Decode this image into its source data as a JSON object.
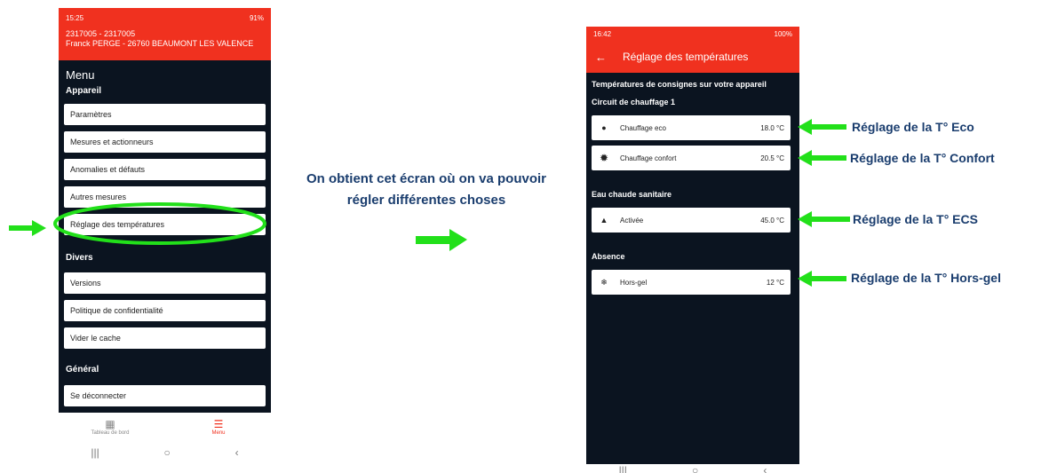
{
  "phone1": {
    "status_time": "15:25",
    "status_battery": "91%",
    "account_line1": "2317005 - 2317005",
    "account_line2": "Franck PERGE - 26760 BEAUMONT LES VALENCE",
    "menu_title": "Menu",
    "section_appareil": "Appareil",
    "appareil_items": [
      "Paramètres",
      "Mesures et actionneurs",
      "Anomalies et défauts",
      "Autres mesures",
      "Réglage des températures"
    ],
    "section_divers": "Divers",
    "divers_items": [
      "Versions",
      "Politique de confidentialité",
      "Vider le cache"
    ],
    "section_general": "Général",
    "general_items": [
      "Se déconnecter"
    ],
    "tab_dashboard": "Tableau de bord",
    "tab_menu": "Menu"
  },
  "center_caption": "On obtient cet écran où on va pouvoir régler différentes choses",
  "phone2": {
    "status_time": "16:42",
    "status_battery": "100%",
    "title": "Réglage des températures",
    "intro": "Températures de consignes sur votre appareil",
    "circuit_title": "Circuit de chauffage 1",
    "chauffage_eco_label": "Chauffage eco",
    "chauffage_eco_value": "18.0 °C",
    "chauffage_confort_label": "Chauffage confort",
    "chauffage_confort_value": "20.5 °C",
    "ecs_title": "Eau chaude sanitaire",
    "ecs_label": "Activée",
    "ecs_value": "45.0 °C",
    "absence_title": "Absence",
    "horsgel_label": "Hors-gel",
    "horsgel_value": "12 °C"
  },
  "annotations": {
    "eco": "Réglage de la T° Eco",
    "confort": "Réglage de la T° Confort",
    "ecs": "Réglage de la T° ECS",
    "horsgel": "Réglage de la T° Hors-gel"
  },
  "colors": {
    "header_red": "#f0311f",
    "screen_bg": "#0b1420",
    "arrow_green": "#22e01a",
    "label_blue": "#1a3d6e"
  }
}
